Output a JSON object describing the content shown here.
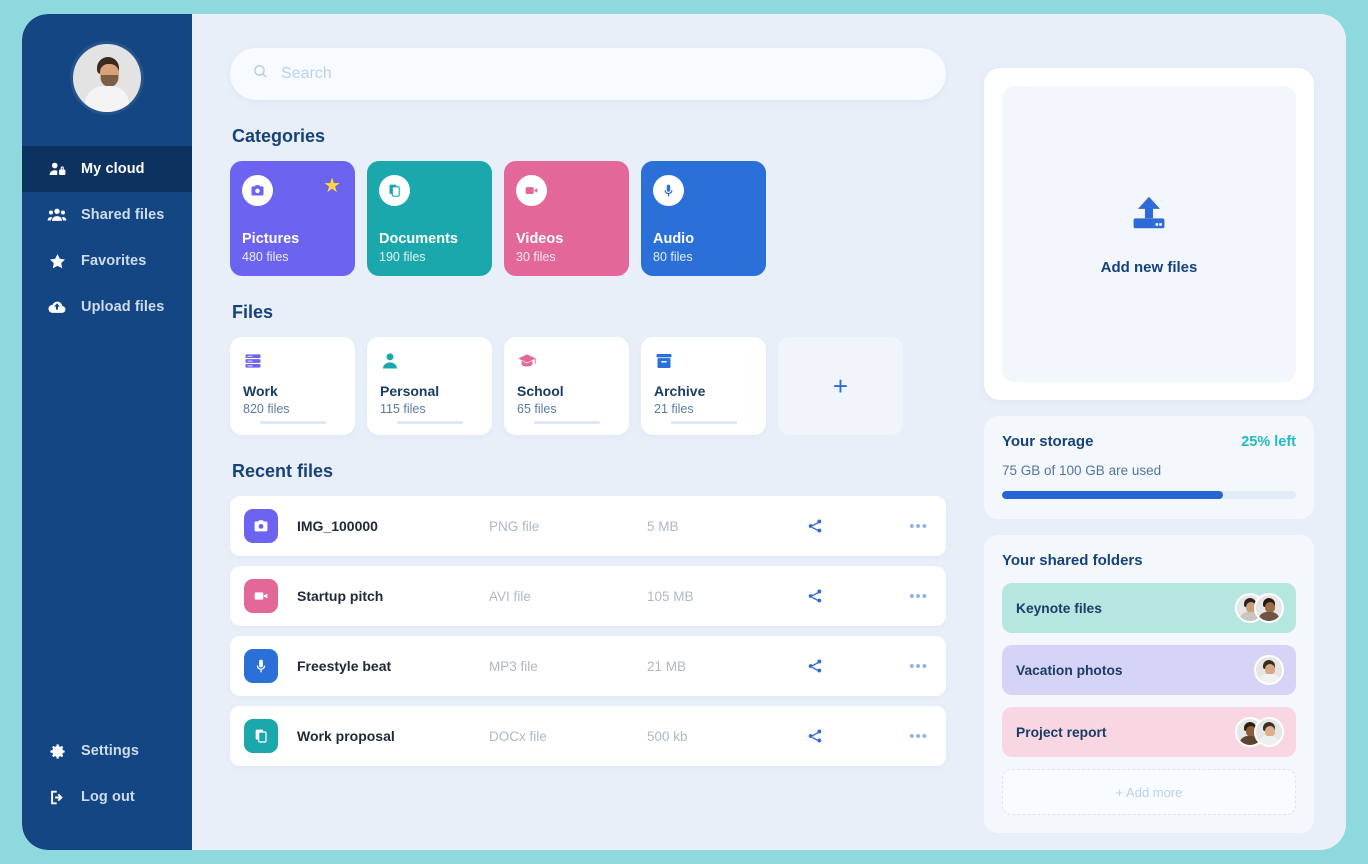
{
  "sidebar": {
    "avatar_alt": "user-avatar",
    "items": [
      {
        "label": "My cloud",
        "icon": "user-lock-icon",
        "active": true
      },
      {
        "label": "Shared files",
        "icon": "users-icon",
        "active": false
      },
      {
        "label": "Favorites",
        "icon": "star-icon",
        "active": false
      },
      {
        "label": "Upload files",
        "icon": "cloud-upload-icon",
        "active": false
      }
    ],
    "bottom_items": [
      {
        "label": "Settings",
        "icon": "gear-icon"
      },
      {
        "label": "Log out",
        "icon": "logout-icon"
      }
    ]
  },
  "search": {
    "placeholder": "Search",
    "value": "",
    "icon": "search-icon"
  },
  "categories": {
    "title": "Categories",
    "items": [
      {
        "name": "Pictures",
        "count": "480 files",
        "icon": "camera-icon",
        "color": "#6c63f0",
        "starred": true,
        "star": "★"
      },
      {
        "name": "Documents",
        "count": "190 files",
        "icon": "documents-icon",
        "color": "#1aa8ac",
        "starred": false,
        "star": ""
      },
      {
        "name": "Videos",
        "count": "30 files",
        "icon": "video-icon",
        "color": "#e4679a",
        "starred": false,
        "star": ""
      },
      {
        "name": "Audio",
        "count": "80 files",
        "icon": "microphone-icon",
        "color": "#2a70d8",
        "starred": false,
        "star": ""
      }
    ]
  },
  "files": {
    "title": "Files",
    "folders": [
      {
        "name": "Work",
        "count": "820 files",
        "icon": "server-icon",
        "color": "#6c63f0"
      },
      {
        "name": "Personal",
        "count": "115 files",
        "icon": "person-icon",
        "color": "#1aa8ac"
      },
      {
        "name": "School",
        "count": "65 files",
        "icon": "graduation-icon",
        "color": "#e4679a"
      },
      {
        "name": "Archive",
        "count": "21 files",
        "icon": "archive-icon",
        "color": "#2a70d8"
      }
    ],
    "add_label": "+"
  },
  "recent": {
    "title": "Recent files",
    "rows": [
      {
        "name": "IMG_100000",
        "type": "PNG file",
        "size": "5 MB",
        "icon": "camera-icon",
        "color": "#6c63f0",
        "share": "share-icon",
        "more": "•••"
      },
      {
        "name": "Startup pitch",
        "type": "AVI file",
        "size": "105 MB",
        "icon": "video-icon",
        "color": "#e4679a",
        "share": "share-icon",
        "more": "•••"
      },
      {
        "name": "Freestyle beat",
        "type": "MP3 file",
        "size": "21 MB",
        "icon": "microphone-icon",
        "color": "#2a70d8",
        "share": "share-icon",
        "more": "•••"
      },
      {
        "name": "Work proposal",
        "type": "DOCx file",
        "size": "500 kb",
        "icon": "documents-icon",
        "color": "#1aa8ac",
        "share": "share-icon",
        "more": "•••"
      }
    ]
  },
  "upload": {
    "label": "Add new files",
    "icon": "upload-icon"
  },
  "storage": {
    "title": "Your storage",
    "left": "25% left",
    "detail": "75 GB of 100 GB are used",
    "percent_used": 75,
    "accent": "#22b8c4",
    "bar_color": "#2565d8"
  },
  "shared": {
    "title": "Your shared folders",
    "items": [
      {
        "name": "Keynote files",
        "color": "#b6e6e0",
        "avatars": 2
      },
      {
        "name": "Vacation photos",
        "color": "#d5d4f7",
        "avatars": 1
      },
      {
        "name": "Project report",
        "color": "#f8d7e3",
        "avatars": 2
      }
    ],
    "add_label": "+ Add more"
  }
}
